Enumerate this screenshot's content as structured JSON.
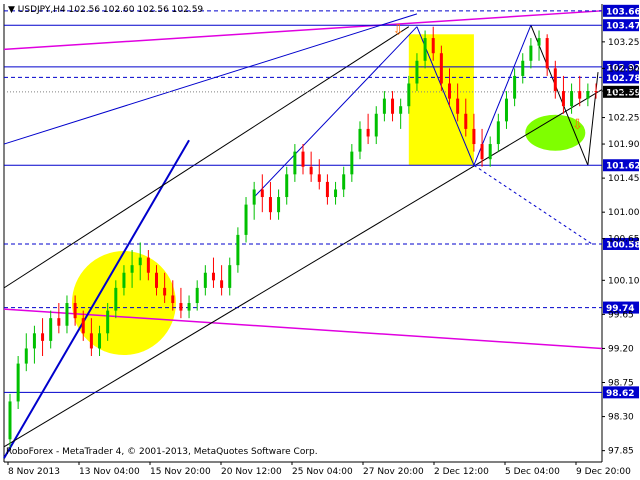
{
  "chart_data": {
    "type": "candlestick",
    "symbol_timeframe": "USDJPY,H4",
    "ohlc_header": "102.56 102.60 102.56 102.59",
    "footer": "RoboForex - MetaTrader 4, © 2001-2013, MetaQuotes Software Corp.",
    "ylim": [
      97.7,
      103.75
    ],
    "y_ticks": [
      "103.25",
      "102.90",
      "102.60",
      "102.25",
      "101.90",
      "101.45",
      "101.00",
      "100.65",
      "100.10",
      "99.65",
      "99.20",
      "98.75",
      "98.30",
      "97.85"
    ],
    "x_ticks": [
      "8 Nov 2013",
      "13 Nov 04:00",
      "15 Nov 20:00",
      "20 Nov 12:00",
      "25 Nov 04:00",
      "27 Nov 20:00",
      "2 Dec 12:00",
      "5 Dec 04:00",
      "9 Dec 20:00"
    ],
    "price_levels": [
      {
        "label": "103.66",
        "value": 103.66,
        "style": "dashed"
      },
      {
        "label": "103.47",
        "value": 103.47,
        "style": "solid"
      },
      {
        "label": "102.92",
        "value": 102.92,
        "style": "solid"
      },
      {
        "label": "102.78",
        "value": 102.78,
        "style": "dashed"
      },
      {
        "label": "102.59",
        "value": 102.59,
        "style": "current"
      },
      {
        "label": "101.62",
        "value": 101.62,
        "style": "solid"
      },
      {
        "label": "100.58",
        "value": 100.58,
        "style": "dashed"
      },
      {
        "label": "99.74",
        "value": 99.74,
        "style": "dashed"
      },
      {
        "label": "98.62",
        "value": 98.62,
        "style": "solid"
      }
    ],
    "series": [
      {
        "values": [
          [
            98.0,
            98.6,
            97.9,
            98.5
          ],
          [
            98.5,
            99.1,
            98.4,
            99.0
          ],
          [
            99.0,
            99.4,
            98.9,
            99.2
          ],
          [
            99.2,
            99.5,
            99.0,
            99.4
          ],
          [
            99.4,
            99.6,
            99.1,
            99.3
          ],
          [
            99.3,
            99.7,
            99.2,
            99.6
          ],
          [
            99.6,
            99.8,
            99.4,
            99.5
          ],
          [
            99.5,
            99.9,
            99.4,
            99.8
          ],
          [
            99.8,
            99.9,
            99.5,
            99.6
          ],
          [
            99.6,
            99.7,
            99.3,
            99.4
          ],
          [
            99.4,
            99.6,
            99.1,
            99.2
          ],
          [
            99.2,
            99.5,
            99.1,
            99.4
          ],
          [
            99.4,
            99.8,
            99.3,
            99.7
          ],
          [
            99.7,
            100.1,
            99.6,
            100.0
          ],
          [
            100.0,
            100.3,
            99.9,
            100.2
          ],
          [
            100.2,
            100.5,
            100.0,
            100.3
          ],
          [
            100.3,
            100.6,
            100.1,
            100.4
          ],
          [
            100.4,
            100.5,
            100.1,
            100.2
          ],
          [
            100.2,
            100.3,
            99.9,
            100.0
          ],
          [
            100.0,
            100.2,
            99.8,
            99.9
          ],
          [
            99.9,
            100.1,
            99.7,
            99.8
          ],
          [
            99.8,
            100.0,
            99.6,
            99.7
          ],
          [
            99.7,
            99.9,
            99.6,
            99.8
          ],
          [
            99.8,
            100.1,
            99.7,
            100.0
          ],
          [
            100.0,
            100.3,
            99.9,
            100.2
          ],
          [
            100.2,
            100.4,
            100.0,
            100.1
          ],
          [
            100.1,
            100.3,
            99.9,
            100.0
          ],
          [
            100.0,
            100.4,
            99.9,
            100.3
          ],
          [
            100.3,
            100.8,
            100.2,
            100.7
          ],
          [
            100.7,
            101.2,
            100.6,
            101.1
          ],
          [
            101.1,
            101.4,
            100.9,
            101.3
          ],
          [
            101.3,
            101.5,
            101.0,
            101.2
          ],
          [
            101.2,
            101.4,
            100.9,
            101.0
          ],
          [
            101.0,
            101.3,
            100.9,
            101.2
          ],
          [
            101.2,
            101.6,
            101.1,
            101.5
          ],
          [
            101.5,
            101.9,
            101.4,
            101.8
          ],
          [
            101.8,
            101.9,
            101.5,
            101.6
          ],
          [
            101.6,
            101.8,
            101.4,
            101.5
          ],
          [
            101.5,
            101.7,
            101.3,
            101.4
          ],
          [
            101.4,
            101.5,
            101.1,
            101.2
          ],
          [
            101.2,
            101.4,
            101.1,
            101.3
          ],
          [
            101.3,
            101.6,
            101.2,
            101.5
          ],
          [
            101.5,
            101.9,
            101.4,
            101.8
          ],
          [
            101.8,
            102.2,
            101.7,
            102.1
          ],
          [
            102.1,
            102.3,
            101.9,
            102.0
          ],
          [
            102.0,
            102.4,
            101.9,
            102.3
          ],
          [
            102.3,
            102.6,
            102.2,
            102.5
          ],
          [
            102.5,
            102.6,
            102.2,
            102.3
          ],
          [
            102.3,
            102.5,
            102.1,
            102.4
          ],
          [
            102.4,
            102.8,
            102.3,
            102.7
          ],
          [
            102.7,
            103.1,
            102.6,
            103.0
          ],
          [
            103.0,
            103.4,
            102.9,
            103.3
          ],
          [
            103.3,
            103.45,
            103.0,
            103.1
          ],
          [
            103.1,
            103.2,
            102.6,
            102.7
          ],
          [
            102.7,
            102.9,
            102.4,
            102.5
          ],
          [
            102.5,
            102.7,
            102.2,
            102.3
          ],
          [
            102.3,
            102.5,
            102.0,
            102.1
          ],
          [
            102.1,
            102.3,
            101.8,
            101.9
          ],
          [
            101.9,
            102.1,
            101.6,
            101.7
          ],
          [
            101.7,
            102.0,
            101.6,
            101.9
          ],
          [
            101.9,
            102.3,
            101.8,
            102.2
          ],
          [
            102.2,
            102.6,
            102.1,
            102.5
          ],
          [
            102.5,
            102.9,
            102.4,
            102.8
          ],
          [
            102.8,
            103.1,
            102.7,
            103.0
          ],
          [
            103.0,
            103.3,
            102.9,
            103.2
          ],
          [
            103.2,
            103.4,
            103.0,
            103.3
          ],
          [
            103.3,
            103.35,
            102.8,
            102.9
          ],
          [
            102.9,
            103.0,
            102.5,
            102.6
          ],
          [
            102.6,
            102.8,
            102.3,
            102.4
          ],
          [
            102.4,
            102.7,
            102.3,
            102.6
          ],
          [
            102.6,
            102.8,
            102.4,
            102.5
          ],
          [
            102.5,
            102.7,
            102.4,
            102.6
          ],
          [
            102.6,
            102.7,
            102.5,
            102.59
          ]
        ]
      }
    ],
    "annotations": [
      {
        "text": "⇩",
        "x_index": 47,
        "y": 103.35,
        "color": "#ff6a00"
      },
      {
        "text": "⇩",
        "x_index": 69,
        "y": 102.1,
        "color": "#ff6a00"
      }
    ]
  },
  "colors": {
    "bull": "#00c000",
    "bear": "#ff0000",
    "axis": "#000000",
    "level_blue": "#0000cc",
    "magenta": "#e000e0",
    "label_bg": "#0000cc",
    "current_label_bg": "#000000",
    "yellow": "#ffff00",
    "green_ellipse": "#7fff00"
  }
}
